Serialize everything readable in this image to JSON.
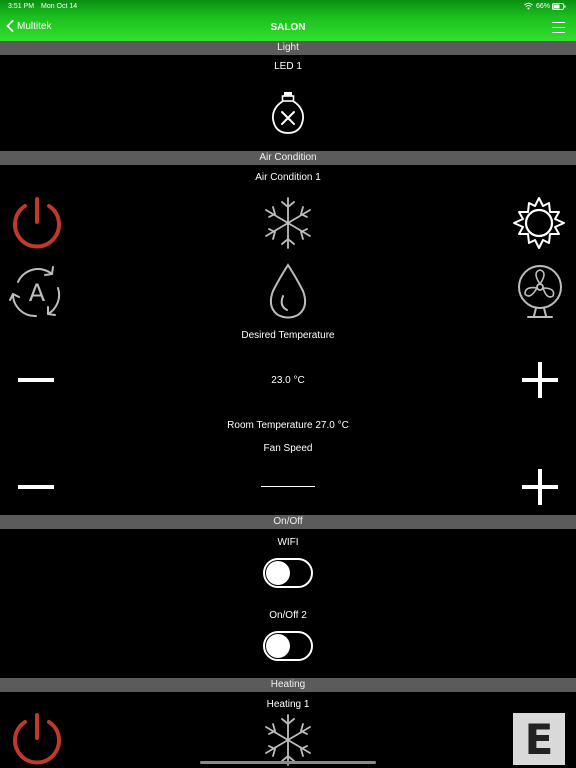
{
  "status_bar": {
    "time": "3:51 PM",
    "date": "Mon Oct 14",
    "battery": "66%"
  },
  "nav": {
    "back_label": "Multitek",
    "title": "SALON"
  },
  "light": {
    "section": "Light",
    "device": "LED 1"
  },
  "air": {
    "section": "Air Condition",
    "device": "Air Condition 1",
    "desired_label": "Desired Temperature",
    "desired_value": "23.0 °C",
    "room_temp": "Room Temperature 27.0 °C",
    "fan_label": "Fan Speed",
    "power_color": "#c0392b"
  },
  "onoff": {
    "section": "On/Off",
    "switch1_label": "WIFI",
    "switch2_label": "On/Off 2"
  },
  "heating": {
    "section": "Heating",
    "device": "Heating 1"
  },
  "logo": {
    "letter": "E"
  }
}
